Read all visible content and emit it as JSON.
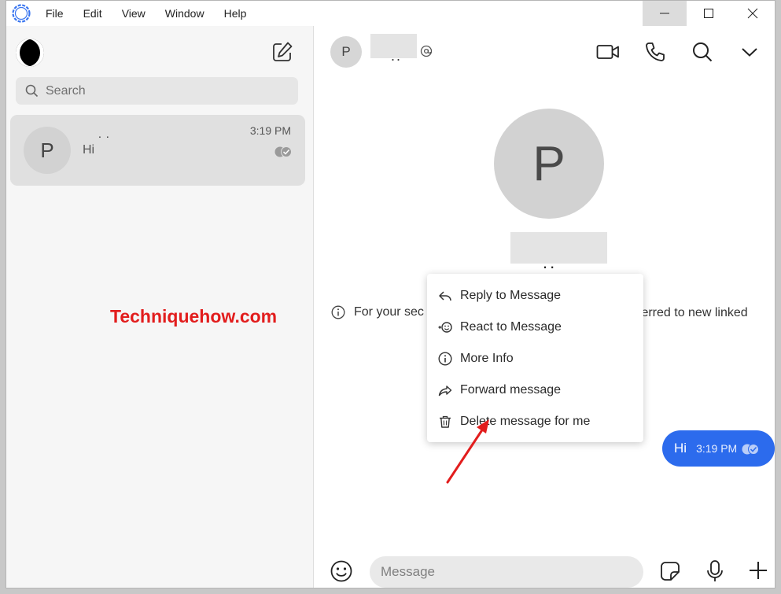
{
  "menu": [
    "File",
    "Edit",
    "View",
    "Window",
    "Help"
  ],
  "sidebar": {
    "search_placeholder": "Search",
    "conversation": {
      "avatar_initial": "P",
      "name": "..",
      "snippet": "Hi",
      "time": "3:19 PM"
    }
  },
  "watermark": "Techniquehow.com",
  "chat": {
    "header_initial": "P",
    "header_name": "..",
    "hero_initial": "P",
    "hero_name": "..",
    "safety_text_start": "For your sec",
    "safety_text_end": "sferred to new linked",
    "bubble_text": "Hi",
    "bubble_time": "3:19 PM",
    "composer_placeholder": "Message"
  },
  "context_menu": [
    {
      "label": "Reply to Message",
      "icon": "reply-icon"
    },
    {
      "label": "React to Message",
      "icon": "react-icon"
    },
    {
      "label": "More Info",
      "icon": "info-icon"
    },
    {
      "label": "Forward message",
      "icon": "forward-icon"
    },
    {
      "label": "Delete message for me",
      "icon": "trash-icon"
    }
  ],
  "colors": {
    "accent": "#2c6bed",
    "watermark": "#e21d1d",
    "arrow": "#e21d1d"
  }
}
